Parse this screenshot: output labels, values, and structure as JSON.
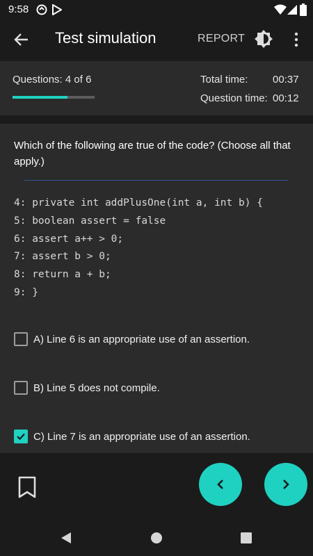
{
  "status_bar": {
    "time": "9:58"
  },
  "app_bar": {
    "title": "Test simulation",
    "report_label": "REPORT"
  },
  "stats": {
    "questions_prefix": "Questions: ",
    "current": "4",
    "of_label": " of ",
    "total": "6",
    "progress": 0.67,
    "total_time_label": "Total time:",
    "total_time_value": "00:37",
    "question_time_label": "Question time:",
    "question_time_value": "00:12"
  },
  "question": {
    "text": "Which of the following are true of the code? (Choose all that apply.)",
    "code_lines": [
      "4: private int addPlusOne(int a, int b) {",
      "5: boolean assert = false",
      "6: assert a++ > 0;",
      "7: assert b > 0;",
      "8: return a + b;",
      "9: }"
    ]
  },
  "options": [
    {
      "label": "A) Line 6 is an appropriate use of an assertion.",
      "checked": false
    },
    {
      "label": "B) Line 5 does not compile.",
      "checked": false
    },
    {
      "label": "C) Line 7 is an appropriate use of an assertion.",
      "checked": true
    }
  ],
  "colors": {
    "accent": "#1fd1c1",
    "card": "#2b2b2b",
    "background": "#1b1b1b",
    "divider": "#2f5a96"
  }
}
